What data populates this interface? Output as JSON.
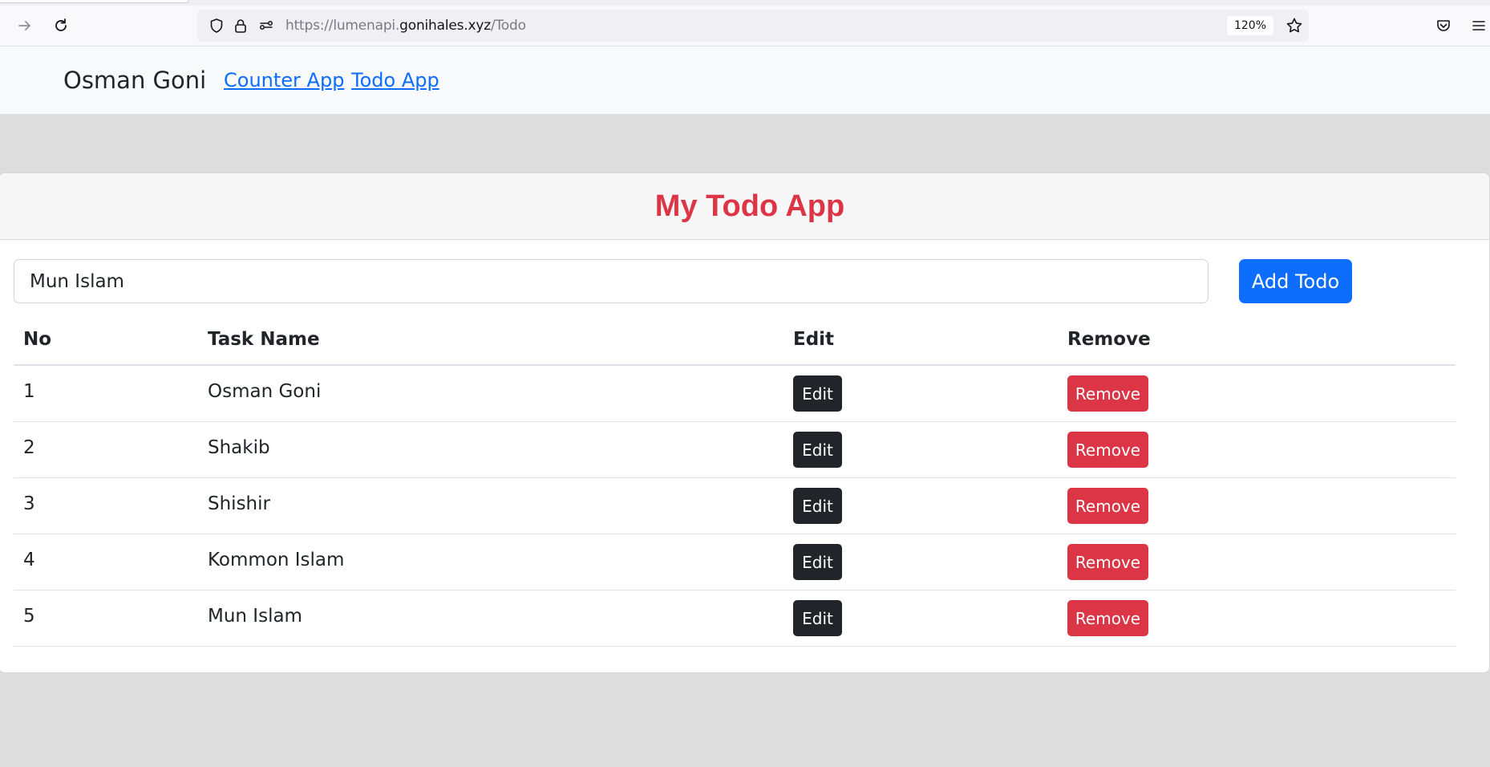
{
  "browser": {
    "url_prefix": "https://lumenapi.",
    "url_domain": "gonihales.xyz",
    "url_path": "/Todo",
    "zoom": "120%"
  },
  "navbar": {
    "brand": "Osman Goni",
    "links": [
      "Counter App",
      "Todo App"
    ]
  },
  "card": {
    "title": "My Todo App"
  },
  "form": {
    "input_value": "Mun Islam",
    "add_button": "Add Todo"
  },
  "table": {
    "headers": [
      "No",
      "Task Name",
      "Edit",
      "Remove"
    ],
    "rows": [
      {
        "no": "1",
        "task": "Osman Goni",
        "edit": "Edit",
        "remove": "Remove"
      },
      {
        "no": "2",
        "task": "Shakib",
        "edit": "Edit",
        "remove": "Remove"
      },
      {
        "no": "3",
        "task": "Shishir",
        "edit": "Edit",
        "remove": "Remove"
      },
      {
        "no": "4",
        "task": "Kommon Islam",
        "edit": "Edit",
        "remove": "Remove"
      },
      {
        "no": "5",
        "task": "Mun Islam",
        "edit": "Edit",
        "remove": "Remove"
      }
    ]
  },
  "colors": {
    "primary": "#0d6efd",
    "danger": "#dc3545",
    "dark": "#212529",
    "page_bg": "#dddddd"
  }
}
